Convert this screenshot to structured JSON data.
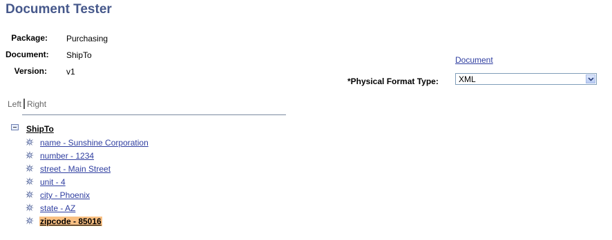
{
  "page": {
    "title": "Document Tester"
  },
  "fields": {
    "package": {
      "label": "Package:",
      "value": "Purchasing"
    },
    "document": {
      "label": "Document:",
      "value": "ShipTo"
    },
    "version": {
      "label": "Version:",
      "value": "v1"
    }
  },
  "document_link": "Document",
  "physical_format": {
    "label": "*Physical Format Type:",
    "selected": "XML"
  },
  "view_toggle": {
    "left": "Left",
    "right": "Right"
  },
  "tree": {
    "root": "ShipTo",
    "items": [
      {
        "label": "name - Sunshine Corporation",
        "selected": false
      },
      {
        "label": "number - 1234",
        "selected": false
      },
      {
        "label": "street - Main Street",
        "selected": false
      },
      {
        "label": "unit - 4",
        "selected": false
      },
      {
        "label": "city - Phoenix",
        "selected": false
      },
      {
        "label": "state - AZ",
        "selected": false
      },
      {
        "label": "zipcode - 85016",
        "selected": true
      }
    ]
  },
  "colors": {
    "title": "#46588b",
    "link": "#2f3ea0",
    "selected_highlight": "#f9c083"
  },
  "icons": {
    "tree_node": "gear-node-icon",
    "collapse": "minus-box-icon",
    "dropdown": "chevron-down-icon"
  }
}
